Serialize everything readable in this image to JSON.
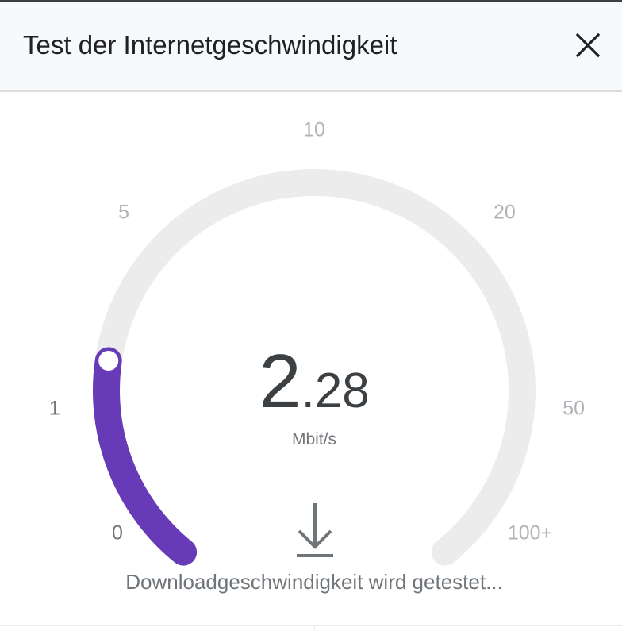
{
  "header": {
    "title": "Test der Internetgeschwindigkeit",
    "close_icon": "close-icon"
  },
  "gauge": {
    "scale_labels": [
      "0",
      "1",
      "5",
      "10",
      "20",
      "50",
      "100+"
    ],
    "active_label_index": 1,
    "progress_fraction": 0.21,
    "colors": {
      "track": "#ececec",
      "progress": "#673ab7",
      "knob_fill": "#ffffff",
      "label": "#b0b3b8",
      "label_active": "#70757a",
      "value": "#3c4043"
    }
  },
  "reading": {
    "integer": "2",
    "decimal": ".28",
    "unit": "Mbit/s"
  },
  "status": {
    "icon": "download-icon",
    "text": "Downloadgeschwindigkeit wird getestet..."
  }
}
